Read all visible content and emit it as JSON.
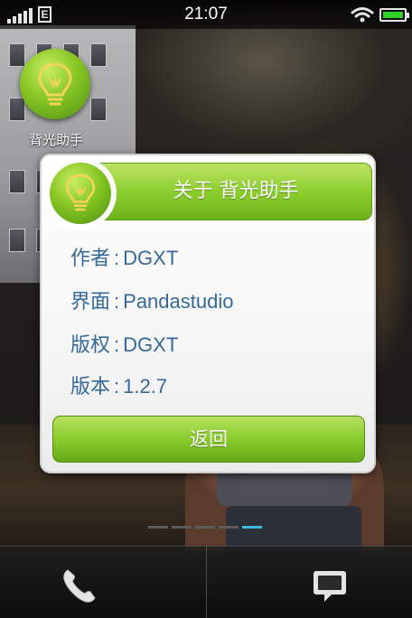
{
  "status_bar": {
    "time": "21:07",
    "network": "E",
    "icons": [
      "signal-icon",
      "edge-network-icon",
      "wifi-icon",
      "battery-icon"
    ]
  },
  "home_app": {
    "label": "背光助手",
    "icon": "lightbulb-icon"
  },
  "dialog": {
    "title": "关于 背光助手",
    "icon": "lightbulb-icon",
    "rows": [
      {
        "label": "作者",
        "value": "DGXT"
      },
      {
        "label": "界面",
        "value": "Pandastudio"
      },
      {
        "label": "版权",
        "value": "DGXT"
      },
      {
        "label": "版本",
        "value": "1.2.7"
      }
    ],
    "separator": ":",
    "back_label": "返回"
  },
  "page_indicator": {
    "count": 5,
    "active_index": 4
  },
  "dock": {
    "items": [
      "phone-icon",
      "messages-icon"
    ]
  },
  "colors": {
    "accent_green": "#8ccf2e",
    "text_blue": "#35699a",
    "page_indicator_active": "#3fb6e0"
  }
}
